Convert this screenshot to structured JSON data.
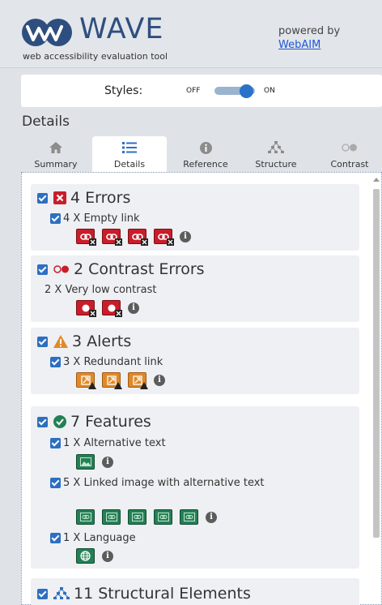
{
  "header": {
    "logo_text": "WAVE",
    "tagline": "web accessibility evaluation tool",
    "powered_by": "powered by",
    "webaim_link": "WebAIM"
  },
  "styles_toggle": {
    "label": "Styles:",
    "off": "OFF",
    "on": "ON",
    "state": "on"
  },
  "section_heading": "Details",
  "tabs": [
    {
      "label": "Summary",
      "icon": "home-icon"
    },
    {
      "label": "Details",
      "icon": "list-icon",
      "active": true
    },
    {
      "label": "Reference",
      "icon": "info-icon"
    },
    {
      "label": "Structure",
      "icon": "structure-icon"
    },
    {
      "label": "Contrast",
      "icon": "contrast-icon"
    }
  ],
  "groups": {
    "errors": {
      "title": "4 Errors",
      "items": [
        {
          "label": "4 X Empty link",
          "count": 4
        }
      ]
    },
    "contrast": {
      "title": "2 Contrast Errors",
      "items": [
        {
          "label": "2 X Very low contrast",
          "count": 2
        }
      ]
    },
    "alerts": {
      "title": "3 Alerts",
      "items": [
        {
          "label": "3 X Redundant link",
          "count": 3
        }
      ]
    },
    "features": {
      "title": "7 Features",
      "items": [
        {
          "label": "1 X Alternative text",
          "count": 1
        },
        {
          "label": "5 X Linked image with alternative text",
          "count": 5
        },
        {
          "label": "1 X Language",
          "count": 1
        }
      ]
    },
    "structural": {
      "title": "11 Structural Elements"
    }
  },
  "colors": {
    "error": "#c91d2a",
    "alert": "#e0892a",
    "feature": "#238055",
    "accent": "#2d6fc2",
    "brand": "#2f4e80"
  }
}
